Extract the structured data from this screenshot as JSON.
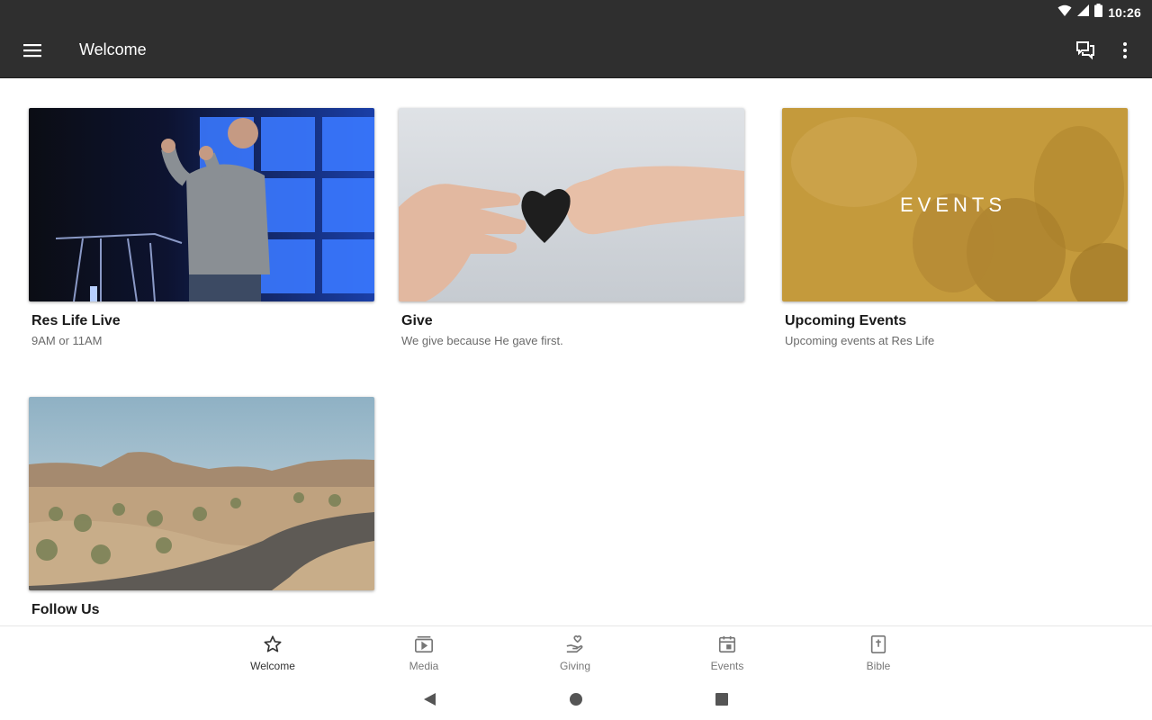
{
  "status_bar": {
    "time": "10:26",
    "icons": [
      "wifi-icon",
      "signal-icon",
      "battery-icon"
    ]
  },
  "app_bar": {
    "title": "Welcome",
    "icons": [
      "menu-icon",
      "chat-icon",
      "more-vert-icon"
    ]
  },
  "cards": [
    {
      "title": "Res Life Live",
      "subtitle": "9AM or 11AM"
    },
    {
      "title": "Give",
      "subtitle": "We give because He gave first."
    },
    {
      "title": "Upcoming Events",
      "subtitle": "Upcoming events at Res Life",
      "image_text": "EVENTS"
    },
    {
      "title": "Follow Us",
      "subtitle": ""
    }
  ],
  "bottom_nav": [
    {
      "label": "Welcome",
      "icon": "star-icon",
      "active": true
    },
    {
      "label": "Media",
      "icon": "media-icon",
      "active": false
    },
    {
      "label": "Giving",
      "icon": "giving-icon",
      "active": false
    },
    {
      "label": "Events",
      "icon": "calendar-icon",
      "active": false
    },
    {
      "label": "Bible",
      "icon": "bible-icon",
      "active": false
    }
  ],
  "system_nav": [
    "back-icon",
    "home-icon",
    "recents-icon"
  ],
  "colors": {
    "bar": "#2f2f2f",
    "events_overlay": "#c49a3c",
    "active_label": "#333333",
    "inactive_label": "#777777"
  }
}
